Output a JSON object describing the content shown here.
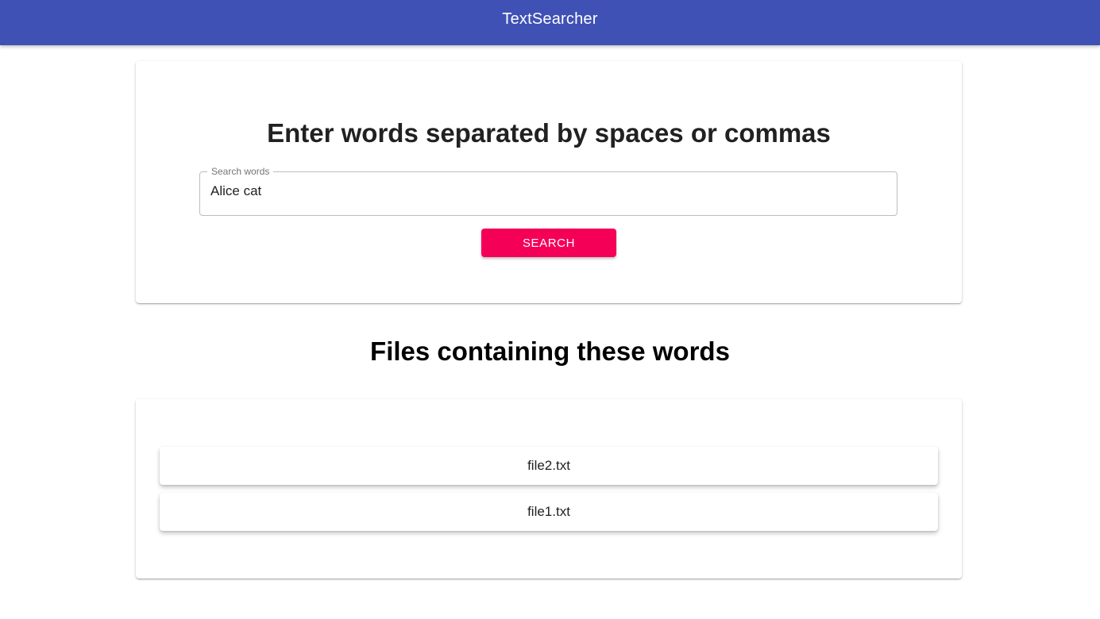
{
  "app_bar": {
    "title": "TextSearcher",
    "color": "#3f51b5"
  },
  "search": {
    "heading": "Enter words separated by spaces or commas",
    "field_label": "Search words",
    "field_value": "Alice cat",
    "button_label": "Search",
    "button_color": "#f50057"
  },
  "results": {
    "heading": "Files containing these words",
    "files": [
      "file2.txt",
      "file1.txt"
    ]
  }
}
